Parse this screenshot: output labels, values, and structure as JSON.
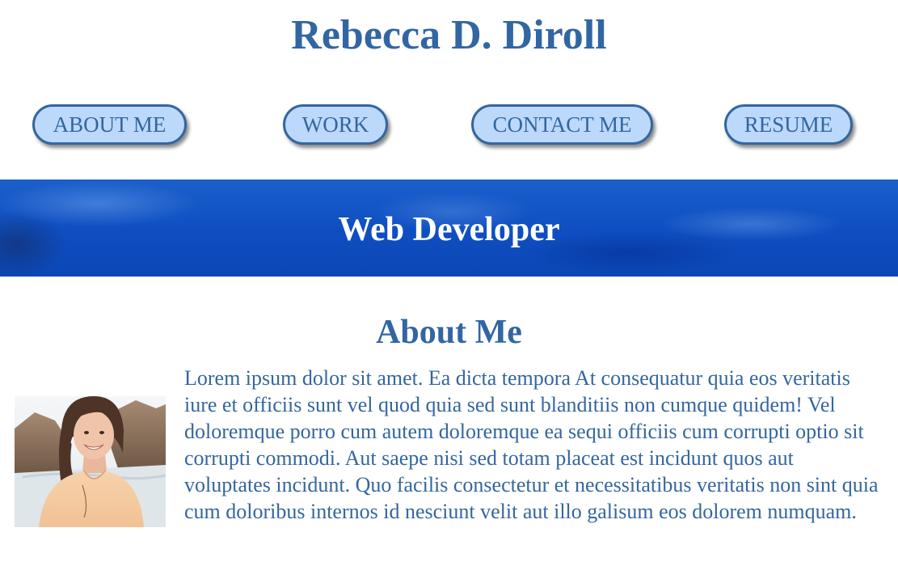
{
  "header": {
    "name": "Rebecca D. Diroll"
  },
  "nav": {
    "items": [
      {
        "label": "ABOUT ME"
      },
      {
        "label": "WORK"
      },
      {
        "label": "CONTACT ME"
      },
      {
        "label": "RESUME"
      }
    ]
  },
  "banner": {
    "title": "Web Developer"
  },
  "about": {
    "title": "About Me",
    "photo_icon": "profile-photo",
    "bio": "Lorem ipsum dolor sit amet. Ea dicta tempora At consequatur quia eos veritatis iure et officiis sunt vel quod quia sed sunt blanditiis non cumque quidem! Vel doloremque porro cum autem doloremque ea sequi officiis cum corrupti optio sit corrupti commodi. Aut saepe nisi sed totam placeat est incidunt quos aut voluptates incidunt. Quo facilis consectetur et necessitatibus veritatis non sint quia cum doloribus internos id nesciunt velit aut illo galisum eos dolorem numquam."
  },
  "colors": {
    "heading": "#3266a3",
    "nav_fill": "#bcd9fb",
    "nav_border": "#3466a0",
    "banner": "#0f4fc2"
  }
}
